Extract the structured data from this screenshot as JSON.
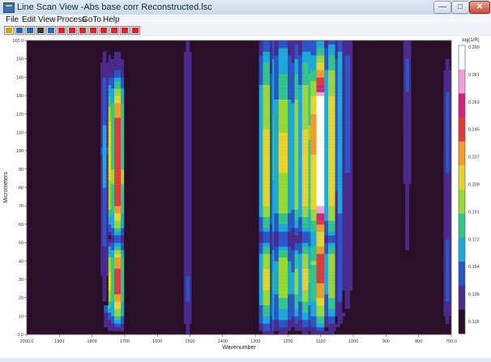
{
  "window": {
    "title": "Line Scan View -Abs base corr Reconstructed.lsc",
    "minimize_label": "—",
    "maximize_label": "□",
    "close_label": "✕"
  },
  "menu": [
    {
      "label": "File"
    },
    {
      "label": "Edit"
    },
    {
      "label": "View"
    },
    {
      "label": "Process"
    },
    {
      "label": "GoTo"
    },
    {
      "label": "Help"
    }
  ],
  "toolbar": {
    "buttons": [
      {
        "name": "open-icon",
        "color": "#d9a21b"
      },
      {
        "name": "bar-chart-icon",
        "color": "#2d62b8"
      },
      {
        "name": "export-icon",
        "color": "#2d62b8"
      },
      {
        "name": "text-abc-icon",
        "color": "#3a3a3a"
      },
      {
        "name": "cursor-icon",
        "color": "#2d62b8"
      },
      {
        "name": "spectrum-select-icon",
        "color": "#d4262e"
      },
      {
        "name": "region-select-icon",
        "color": "#d4262e"
      },
      {
        "name": "peak-mark-icon",
        "color": "#d4262e"
      },
      {
        "name": "vertical-split-icon",
        "color": "#d4262e"
      },
      {
        "name": "baseline-icon",
        "color": "#d4262e"
      },
      {
        "name": "arrow-down-icon",
        "color": "#d4262e"
      },
      {
        "name": "arrow-right-icon",
        "color": "#d4262e"
      },
      {
        "name": "scatter-icon",
        "color": "#d4262e"
      }
    ]
  },
  "chart_data": {
    "type": "heatmap",
    "xlabel": "Wavenumber",
    "ylabel": "Micrometers",
    "xlim": [
      2000,
      700
    ],
    "ylim": [
      0,
      160
    ],
    "x_ticks": [
      "2000.0",
      "1900",
      "1800",
      "1700",
      "1600",
      "1500",
      "1400",
      "1300",
      "1200",
      "1100",
      "1000",
      "900",
      "800",
      "700.0"
    ],
    "y_ticks": [
      "0.0",
      "10",
      "20",
      "30",
      "40",
      "50",
      "60",
      "70",
      "80",
      "90",
      "100",
      "110",
      "120",
      "130",
      "140",
      "150",
      "160.0"
    ],
    "colorbar_title": "log(1/R)",
    "colorbar_ticks": [
      "0.299",
      "0.281",
      "0.263",
      "0.245",
      "0.227",
      "0.209",
      "0.191",
      "0.172",
      "0.154",
      "0.136",
      "0.118"
    ],
    "colorbar_range": [
      0.1,
      0.299
    ],
    "colors": {
      "background": "#2b0f28",
      "scale": [
        "#2b0f28",
        "#4a2a8c",
        "#2a56c8",
        "#1ea8d8",
        "#35c48a",
        "#9ad83a",
        "#e6d52a",
        "#f29a2a",
        "#e23a3a",
        "#d4237f",
        "#f0a0d8",
        "#ffffff"
      ]
    },
    "bands": [
      {
        "wavenumber": 1740,
        "width": 6,
        "profile": [
          [
            0,
            0.1
          ],
          [
            8,
            0.13
          ],
          [
            20,
            0.19
          ],
          [
            30,
            0.21
          ],
          [
            42,
            0.18
          ],
          [
            48,
            0.14
          ],
          [
            52,
            0.1
          ],
          [
            58,
            0.14
          ],
          [
            70,
            0.19
          ],
          [
            85,
            0.2
          ],
          [
            100,
            0.21
          ],
          [
            115,
            0.2
          ],
          [
            125,
            0.18
          ],
          [
            135,
            0.15
          ],
          [
            142,
            0.12
          ],
          [
            160,
            0.1
          ]
        ]
      },
      {
        "wavenumber": 1722,
        "width": 5,
        "profile": [
          [
            0,
            0.1
          ],
          [
            8,
            0.17
          ],
          [
            20,
            0.23
          ],
          [
            30,
            0.25
          ],
          [
            42,
            0.22
          ],
          [
            48,
            0.17
          ],
          [
            52,
            0.12
          ],
          [
            58,
            0.18
          ],
          [
            70,
            0.24
          ],
          [
            85,
            0.25
          ],
          [
            100,
            0.245
          ],
          [
            115,
            0.24
          ],
          [
            125,
            0.22
          ],
          [
            135,
            0.18
          ],
          [
            142,
            0.13
          ],
          [
            160,
            0.1
          ]
        ]
      },
      {
        "wavenumber": 1762,
        "width": 3,
        "profile": [
          [
            0,
            0.1
          ],
          [
            40,
            0.12
          ],
          [
            60,
            0.14
          ],
          [
            100,
            0.15
          ],
          [
            130,
            0.14
          ],
          [
            160,
            0.1
          ]
        ]
      },
      {
        "wavenumber": 1507,
        "width": 3,
        "profile": [
          [
            0,
            0.11
          ],
          [
            20,
            0.13
          ],
          [
            60,
            0.12
          ],
          [
            100,
            0.12
          ],
          [
            150,
            0.12
          ],
          [
            160,
            0.11
          ]
        ]
      },
      {
        "wavenumber": 1265,
        "width": 6,
        "profile": [
          [
            0,
            0.11
          ],
          [
            8,
            0.16
          ],
          [
            20,
            0.19
          ],
          [
            30,
            0.21
          ],
          [
            42,
            0.19
          ],
          [
            48,
            0.16
          ],
          [
            52,
            0.13
          ],
          [
            58,
            0.16
          ],
          [
            70,
            0.2
          ],
          [
            90,
            0.21
          ],
          [
            110,
            0.2
          ],
          [
            130,
            0.19
          ],
          [
            145,
            0.17
          ],
          [
            160,
            0.13
          ]
        ]
      },
      {
        "wavenumber": 1240,
        "width": 4,
        "profile": [
          [
            0,
            0.12
          ],
          [
            10,
            0.15
          ],
          [
            30,
            0.17
          ],
          [
            50,
            0.14
          ],
          [
            70,
            0.16
          ],
          [
            110,
            0.17
          ],
          [
            140,
            0.15
          ],
          [
            160,
            0.14
          ]
        ]
      },
      {
        "wavenumber": 1215,
        "width": 7,
        "profile": [
          [
            0,
            0.11
          ],
          [
            8,
            0.15
          ],
          [
            20,
            0.18
          ],
          [
            30,
            0.2
          ],
          [
            42,
            0.18
          ],
          [
            48,
            0.15
          ],
          [
            52,
            0.13
          ],
          [
            58,
            0.16
          ],
          [
            70,
            0.19
          ],
          [
            90,
            0.2
          ],
          [
            110,
            0.2
          ],
          [
            130,
            0.18
          ],
          [
            145,
            0.16
          ],
          [
            160,
            0.14
          ]
        ]
      },
      {
        "wavenumber": 1170,
        "width": 5,
        "profile": [
          [
            0,
            0.1
          ],
          [
            8,
            0.14
          ],
          [
            20,
            0.18
          ],
          [
            30,
            0.19
          ],
          [
            42,
            0.17
          ],
          [
            48,
            0.14
          ],
          [
            52,
            0.12
          ],
          [
            58,
            0.15
          ],
          [
            70,
            0.19
          ],
          [
            90,
            0.19
          ],
          [
            110,
            0.19
          ],
          [
            130,
            0.18
          ],
          [
            145,
            0.16
          ],
          [
            160,
            0.12
          ]
        ]
      },
      {
        "wavenumber": 1145,
        "width": 6,
        "profile": [
          [
            0,
            0.11
          ],
          [
            8,
            0.15
          ],
          [
            20,
            0.19
          ],
          [
            30,
            0.21
          ],
          [
            42,
            0.19
          ],
          [
            48,
            0.16
          ],
          [
            52,
            0.13
          ],
          [
            58,
            0.16
          ],
          [
            70,
            0.2
          ],
          [
            90,
            0.21
          ],
          [
            110,
            0.2
          ],
          [
            130,
            0.19
          ],
          [
            145,
            0.17
          ],
          [
            160,
            0.13
          ]
        ]
      },
      {
        "wavenumber": 1118,
        "width": 5,
        "profile": [
          [
            0,
            0.11
          ],
          [
            8,
            0.15
          ],
          [
            20,
            0.2
          ],
          [
            30,
            0.22
          ],
          [
            42,
            0.21
          ],
          [
            48,
            0.18
          ],
          [
            52,
            0.16
          ],
          [
            58,
            0.19
          ],
          [
            70,
            0.22
          ],
          [
            90,
            0.24
          ],
          [
            110,
            0.25
          ],
          [
            130,
            0.24
          ],
          [
            145,
            0.21
          ],
          [
            160,
            0.16
          ]
        ]
      },
      {
        "wavenumber": 1095,
        "width": 9,
        "profile": [
          [
            0,
            0.12
          ],
          [
            8,
            0.17
          ],
          [
            20,
            0.22
          ],
          [
            30,
            0.24
          ],
          [
            40,
            0.25
          ],
          [
            48,
            0.22
          ],
          [
            52,
            0.2
          ],
          [
            58,
            0.23
          ],
          [
            70,
            0.29
          ],
          [
            90,
            0.31
          ],
          [
            110,
            0.32
          ],
          [
            125,
            0.31
          ],
          [
            135,
            0.26
          ],
          [
            145,
            0.21
          ],
          [
            160,
            0.15
          ]
        ]
      },
      {
        "wavenumber": 1065,
        "width": 6,
        "profile": [
          [
            0,
            0.1
          ],
          [
            8,
            0.14
          ],
          [
            20,
            0.18
          ],
          [
            30,
            0.2
          ],
          [
            42,
            0.19
          ],
          [
            48,
            0.16
          ],
          [
            52,
            0.14
          ],
          [
            58,
            0.17
          ],
          [
            70,
            0.2
          ],
          [
            90,
            0.21
          ],
          [
            110,
            0.21
          ],
          [
            130,
            0.2
          ],
          [
            145,
            0.18
          ],
          [
            160,
            0.14
          ]
        ]
      },
      {
        "wavenumber": 1040,
        "width": 4,
        "profile": [
          [
            0,
            0.1
          ],
          [
            20,
            0.13
          ],
          [
            50,
            0.14
          ],
          [
            80,
            0.15
          ],
          [
            110,
            0.15
          ],
          [
            140,
            0.16
          ],
          [
            160,
            0.14
          ]
        ]
      },
      {
        "wavenumber": 1018,
        "width": 4,
        "profile": [
          [
            0,
            0.1
          ],
          [
            30,
            0.12
          ],
          [
            60,
            0.12
          ],
          [
            100,
            0.13
          ],
          [
            140,
            0.14
          ],
          [
            160,
            0.12
          ]
        ]
      },
      {
        "wavenumber": 835,
        "width": 3,
        "profile": [
          [
            0,
            0.1
          ],
          [
            50,
            0.11
          ],
          [
            100,
            0.12
          ],
          [
            145,
            0.13
          ],
          [
            160,
            0.12
          ]
        ]
      },
      {
        "wavenumber": 712,
        "width": 3,
        "profile": [
          [
            0,
            0.1
          ],
          [
            20,
            0.13
          ],
          [
            40,
            0.14
          ],
          [
            60,
            0.12
          ],
          [
            100,
            0.13
          ],
          [
            120,
            0.14
          ],
          [
            140,
            0.12
          ],
          [
            160,
            0.1
          ]
        ]
      }
    ]
  }
}
